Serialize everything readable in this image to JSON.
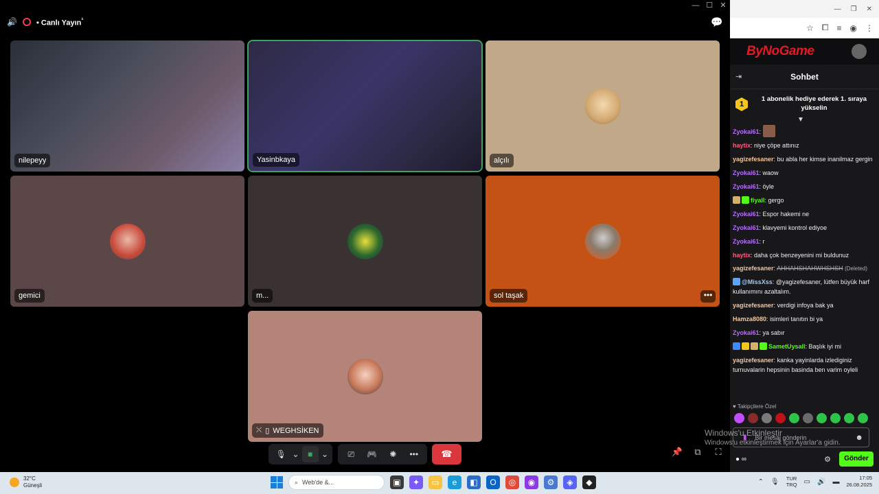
{
  "call": {
    "title": "Canlı Yayın",
    "title_mark": "¹",
    "participants": [
      {
        "name": "nilepeyy",
        "type": "camera"
      },
      {
        "name": "Yasinbkaya",
        "type": "camera",
        "speaking": true
      },
      {
        "name": "alçılı",
        "type": "avatar",
        "bg": "#c0a888"
      },
      {
        "name": "gemici",
        "type": "avatar",
        "bg": "#5b4747"
      },
      {
        "name": "m...",
        "type": "avatar",
        "bg": "#3a3232"
      },
      {
        "name": "sol taşak",
        "type": "avatar",
        "bg": "#c45214"
      },
      {
        "name": "WEGHSİKEN",
        "type": "avatar",
        "bg": "#b48478"
      }
    ],
    "more_label": "•••"
  },
  "chat": {
    "site_logo": "ByNoGame",
    "title": "Sohbet",
    "promo_rank": "1",
    "promo_text": "1 abonelik hediye ederek 1. sıraya yükselin",
    "messages": [
      {
        "user": "Zyokai61",
        "color": "#b86dff",
        "text": "",
        "emote": true
      },
      {
        "user": "haytix",
        "color": "#ff5c7a",
        "text": "niye çöpe attınız"
      },
      {
        "user": "yagizefesaner",
        "color": "#f5c69c",
        "text": "bu abla her kimse inanilmaz gergin"
      },
      {
        "user": "Zyokai61",
        "color": "#b86dff",
        "text": "waow"
      },
      {
        "user": "Zyokai61",
        "color": "#b86dff",
        "text": "öyle"
      },
      {
        "user": "fiyall",
        "color": "#53fc18",
        "text": "gergo",
        "badges": [
          "#d4b26a",
          "#53fc18"
        ]
      },
      {
        "user": "Zyokai61",
        "color": "#b86dff",
        "text": "Espor hakemi ne"
      },
      {
        "user": "Zyokai61",
        "color": "#b86dff",
        "text": "klavyemi kontrol ediyoe"
      },
      {
        "user": "Zyokai61",
        "color": "#b86dff",
        "text": "r"
      },
      {
        "user": "haytix",
        "color": "#ff5c7a",
        "text": "daha çok benzeyenini mi buldunuz"
      },
      {
        "user": "yagizefesaner",
        "color": "#f5c69c",
        "text": "AHHAHSHAHWHSHSH",
        "deleted": "(Deleted)"
      },
      {
        "user": "@MissXss",
        "color": "#9ecbff",
        "text": "@yagizefesaner, lütfen büyük harf kullanımını azaltalım.",
        "badges": [
          "#58a6ff"
        ]
      },
      {
        "user": "yagizefesaner",
        "color": "#f5c69c",
        "text": "verdigi infoya bak ya"
      },
      {
        "user": "Hamza8080",
        "color": "#f5c69c",
        "text": "isimleri tanıtın bi ya"
      },
      {
        "user": "Zyokai61",
        "color": "#b86dff",
        "text": "ya sabır"
      },
      {
        "user": "SametUysall",
        "color": "#53fc18",
        "text": "Başlık iyi mi",
        "badges": [
          "#3d8bfd",
          "#f5c518",
          "#d4b26a",
          "#53fc18"
        ]
      },
      {
        "user": "yagizefesaner",
        "color": "#f5c69c",
        "text": "kanka yayinlarda izlediginiz turnuvalarin hepsinin basinda ben varim oyleli"
      }
    ],
    "followers_label": "♥ Takipçilere Özel",
    "input_placeholder": "Bir mesaj gönderin",
    "points_label": "∞",
    "send_label": "Gönder"
  },
  "watermark": {
    "title": "Windows'u Etkinleştir",
    "sub": "Windows'u etkinleştirmek için Ayarlar'a gidin."
  },
  "taskbar": {
    "weather_temp": "32°C",
    "weather_desc": "Güneşli",
    "search_placeholder": "Web'de &...",
    "lang_top": "TUR",
    "lang_bottom": "TRQ",
    "time": "17:05",
    "date": "26.08.2025"
  }
}
